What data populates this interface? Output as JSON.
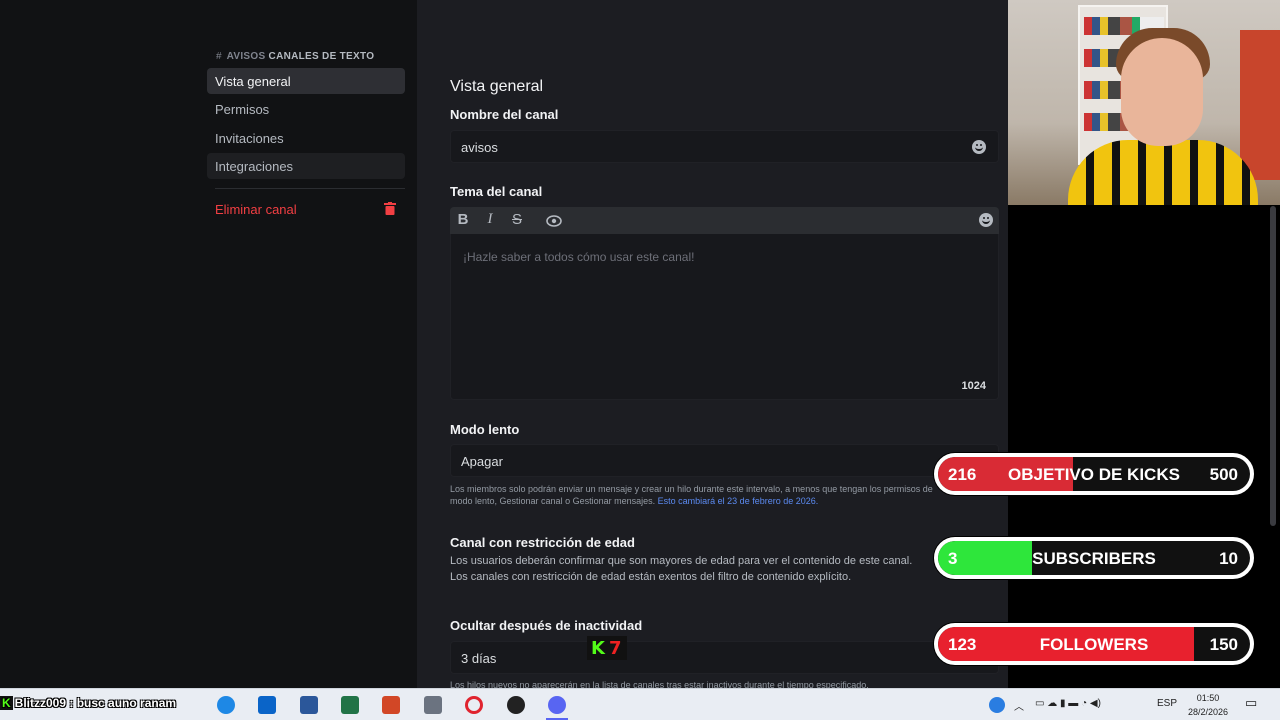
{
  "sidebar": {
    "header_hash": "#",
    "header_channel": "AVISOS",
    "header_section": "CANALES DE TEXTO",
    "items": [
      {
        "label": "Vista general"
      },
      {
        "label": "Permisos"
      },
      {
        "label": "Invitaciones"
      },
      {
        "label": "Integraciones"
      }
    ],
    "delete_label": "Eliminar canal"
  },
  "main": {
    "title": "Vista general",
    "channel_name_label": "Nombre del canal",
    "channel_name_value": "avisos",
    "topic_label": "Tema del canal",
    "topic_placeholder": "¡Hazle saber a todos cómo usar este canal!",
    "topic_counter": "1024",
    "toolbar": {
      "bold": "B",
      "italic": "I",
      "strike": "S"
    },
    "slowmode_label": "Modo lento",
    "slowmode_value": "Apagar",
    "slowmode_help": "Los miembros solo podrán enviar un mensaje y crear un hilo durante este intervalo, a menos que tengan los permisos de",
    "slowmode_help2": "modo lento, Gestionar canal o Gestionar mensajes.",
    "slowmode_link": "Esto cambiará el 23 de febrero de 2026.",
    "age_label": "Canal con restricción de edad",
    "age_desc1": "Los usuarios deberán confirmar que son mayores de edad para ver el contenido de este canal.",
    "age_desc2": "Los canales con restricción de edad están exentos del filtro de contenido explícito.",
    "hide_label": "Ocultar después de inactividad",
    "hide_value": "3 días",
    "hide_help": "Los hilos nuevos no aparecerán en la lista de canales tras estar inactivos durante el tiempo especificado."
  },
  "goals": [
    {
      "current": "216",
      "name": "OBJETIVO DE KICKS",
      "max": "500",
      "progress": 0.432,
      "color": "#d92b35"
    },
    {
      "current": "3",
      "name": "SUBSCRIBERS",
      "max": "10",
      "progress": 0.3,
      "color": "#2ee63b"
    },
    {
      "current": "123",
      "name": "FOLLOWERS",
      "max": "150",
      "progress": 0.82,
      "color": "#e8212e"
    }
  ],
  "kick_badge": {
    "k": "K",
    "n": "7"
  },
  "taskbar": {
    "ticker_k": "K",
    "ticker_text": "Blitzz009 : busc auno ranam",
    "lang": "ESP",
    "time": "01:50",
    "date": "28/2/2026"
  }
}
